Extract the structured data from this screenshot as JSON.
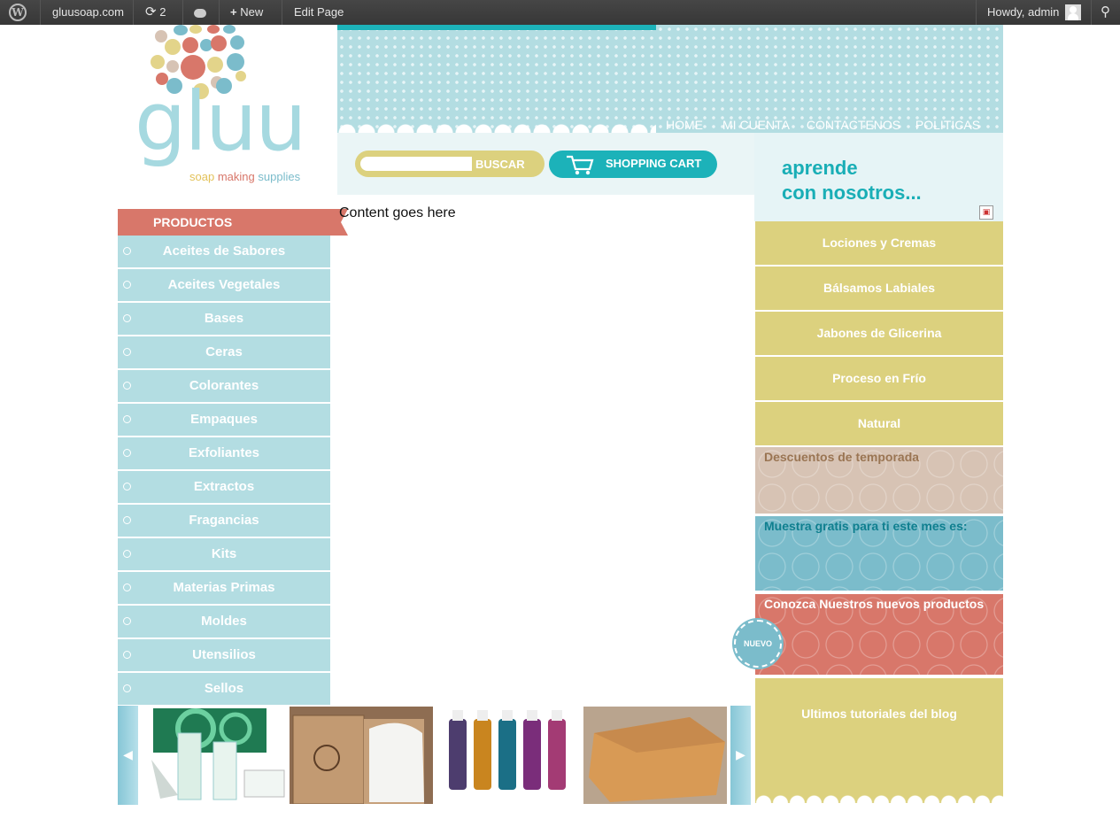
{
  "adminbar": {
    "site_name": "gluusoap.com",
    "updates_count": "2",
    "new_label": "New",
    "edit_label": "Edit Page",
    "greeting": "Howdy, admin"
  },
  "logo": {
    "name": "gluu",
    "tagline_1": "soap",
    "tagline_2": "making",
    "tagline_3": "supplies"
  },
  "nav": {
    "tabs": [
      {
        "label": "HOME",
        "color": "#1cb2b9"
      },
      {
        "label": "MI CUENTA",
        "color": "#d8776a"
      },
      {
        "label": "CONTACTENOS",
        "color": "#dcd17e"
      },
      {
        "label": "POLITICAS",
        "color": "#d7c3b4"
      }
    ]
  },
  "search": {
    "value": "",
    "button_label": "BUSCAR"
  },
  "cart": {
    "label": "SHOPPING CART"
  },
  "aprende": {
    "text": "aprende\ncon nosotros..."
  },
  "sidebar": {
    "heading": "PRODUCTOS",
    "items": [
      "Aceites de Sabores",
      "Aceites Vegetales",
      "Bases",
      "Ceras",
      "Colorantes",
      "Empaques",
      "Exfoliantes",
      "Extractos",
      "Fragancias",
      "Kits",
      "Materias Primas",
      "Moldes",
      "Utensilios",
      "Sellos"
    ]
  },
  "main": {
    "content": "Content goes here"
  },
  "right": {
    "categories": [
      "Lociones y Cremas",
      "Bálsamos Labiales",
      "Jabones de Glicerina",
      "Proceso en Frío",
      "Natural"
    ],
    "promos": [
      {
        "text": "Descuentos de temporada",
        "bg": "#d7c3b4",
        "color": "#9a7553"
      },
      {
        "text": "Muestra gratis para ti este mes es:",
        "bg": "#7bbccb",
        "color": "#0f7f8f"
      },
      {
        "text": "Conozca Nuestros nuevos productos",
        "bg": "#d8776a",
        "color": "#ffffff"
      }
    ],
    "badge": "NUEVO",
    "blog": "Ultimos tutoriales del blog"
  },
  "colors": {
    "teal": "#1cb2b9",
    "light_blue": "#b3dde2",
    "coral": "#d8776a",
    "yellow": "#dcd17e",
    "beige": "#d7c3b4"
  }
}
